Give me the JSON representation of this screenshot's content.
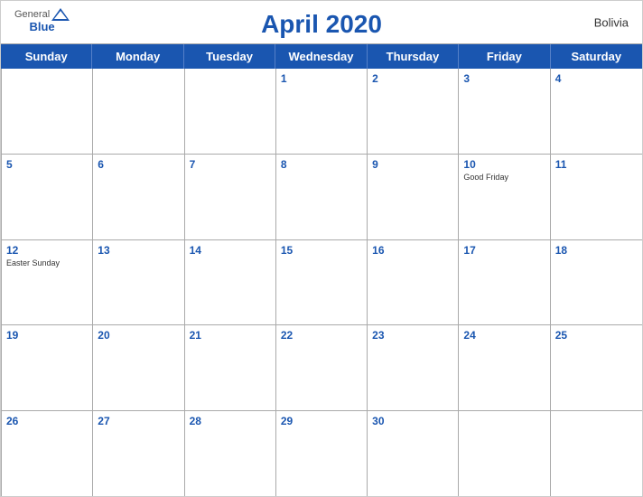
{
  "header": {
    "logo": {
      "general": "General",
      "blue": "Blue"
    },
    "title": "April 2020",
    "country": "Bolivia"
  },
  "day_headers": [
    "Sunday",
    "Monday",
    "Tuesday",
    "Wednesday",
    "Thursday",
    "Friday",
    "Saturday"
  ],
  "weeks": [
    [
      {
        "day": "",
        "holiday": ""
      },
      {
        "day": "",
        "holiday": ""
      },
      {
        "day": "",
        "holiday": ""
      },
      {
        "day": "1",
        "holiday": ""
      },
      {
        "day": "2",
        "holiday": ""
      },
      {
        "day": "3",
        "holiday": ""
      },
      {
        "day": "4",
        "holiday": ""
      }
    ],
    [
      {
        "day": "5",
        "holiday": ""
      },
      {
        "day": "6",
        "holiday": ""
      },
      {
        "day": "7",
        "holiday": ""
      },
      {
        "day": "8",
        "holiday": ""
      },
      {
        "day": "9",
        "holiday": ""
      },
      {
        "day": "10",
        "holiday": "Good Friday"
      },
      {
        "day": "11",
        "holiday": ""
      }
    ],
    [
      {
        "day": "12",
        "holiday": "Easter Sunday"
      },
      {
        "day": "13",
        "holiday": ""
      },
      {
        "day": "14",
        "holiday": ""
      },
      {
        "day": "15",
        "holiday": ""
      },
      {
        "day": "16",
        "holiday": ""
      },
      {
        "day": "17",
        "holiday": ""
      },
      {
        "day": "18",
        "holiday": ""
      }
    ],
    [
      {
        "day": "19",
        "holiday": ""
      },
      {
        "day": "20",
        "holiday": ""
      },
      {
        "day": "21",
        "holiday": ""
      },
      {
        "day": "22",
        "holiday": ""
      },
      {
        "day": "23",
        "holiday": ""
      },
      {
        "day": "24",
        "holiday": ""
      },
      {
        "day": "25",
        "holiday": ""
      }
    ],
    [
      {
        "day": "26",
        "holiday": ""
      },
      {
        "day": "27",
        "holiday": ""
      },
      {
        "day": "28",
        "holiday": ""
      },
      {
        "day": "29",
        "holiday": ""
      },
      {
        "day": "30",
        "holiday": ""
      },
      {
        "day": "",
        "holiday": ""
      },
      {
        "day": "",
        "holiday": ""
      }
    ]
  ]
}
